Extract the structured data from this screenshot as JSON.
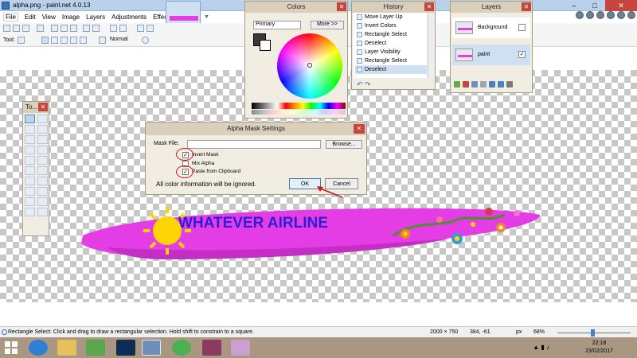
{
  "window": {
    "title": "alpha.png - paint.net 4.0.13"
  },
  "menu": [
    "File",
    "Edit",
    "View",
    "Image",
    "Layers",
    "Adjustments",
    "Effects"
  ],
  "toolbar": {
    "tool_label": "Tool:",
    "blend_mode": "Normal"
  },
  "colors_window": {
    "title": "Colors",
    "mode": "Primary",
    "more_label": "More >>"
  },
  "history_window": {
    "title": "History",
    "items": [
      "Move Layer Up",
      "Invert Colors",
      "Rectangle Select",
      "Deselect",
      "Layer Visibility",
      "Rectangle Select",
      "Deselect"
    ],
    "selected_index": 6
  },
  "layers_window": {
    "title": "Layers",
    "layers": [
      {
        "name": "Background",
        "visible": false
      },
      {
        "name": "paint",
        "visible": true
      }
    ]
  },
  "tools_window": {
    "title": "To..."
  },
  "dialog": {
    "title": "Alpha Mask Settings",
    "mask_file_label": "Mask File:",
    "browse_label": "Browse...",
    "options": [
      {
        "label": "Invert Mask",
        "checked": true
      },
      {
        "label": "Mix Alpha",
        "checked": false
      },
      {
        "label": "Paste from Clipboard",
        "checked": true
      }
    ],
    "info": "All color information will be ignored.",
    "ok_label": "OK",
    "cancel_label": "Cancel"
  },
  "canvas": {
    "banner_text": "WHATEVER AIRLINE"
  },
  "statusbar": {
    "hint": "Rectangle Select: Click and drag to draw a rectangular selection. Hold shift to constrain to a square.",
    "image_size": "2000 × 750",
    "cursor": "384, -61",
    "units": "px",
    "zoom": "68%"
  },
  "taskbar": {
    "time": "22:18",
    "date": "23/02/2017"
  },
  "colors": {
    "accent": "#3a6fb7",
    "banner": "#e53de5",
    "close": "#c7463b"
  }
}
